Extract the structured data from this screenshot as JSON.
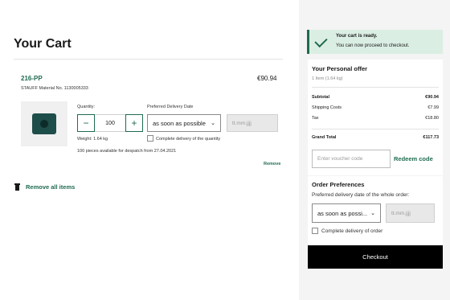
{
  "cart": {
    "title": "Your Cart",
    "remove_all_label": "Remove all items",
    "item": {
      "sku": "216-PP",
      "price": "€90.94",
      "material_no": "STAUFF Material No. 1130005333",
      "quantity_label": "Quantity:",
      "quantity_value": "100",
      "minus_glyph": "−",
      "plus_glyph": "+",
      "delivery_date_label": "Preferred Delivery Date",
      "delivery_option": "as soon as possible",
      "date_placeholder": "tt.mm.jjjj",
      "complete_delivery_label": "Complete delivery of the quantity",
      "weight": "Weight: 1.64 kg",
      "availability": "100 pieces available for despatch from 27.04.2021",
      "remove_label": "Remove"
    }
  },
  "notice": {
    "title": "Your cart is ready.",
    "message": "You can now proceed to checkout."
  },
  "offer": {
    "title": "Your Personal offer",
    "summary": "1 Item (1.64 kg)",
    "rows": [
      {
        "label": "Subtotal",
        "value": "€90.94"
      },
      {
        "label": "Shipping Costs",
        "value": "€7.99"
      },
      {
        "label": "Tax",
        "value": "€18.80"
      }
    ],
    "grand_total_label": "Grand Total",
    "grand_total_value": "€117.73",
    "voucher_placeholder": "Enter voucher code",
    "redeem_label": "Redeem code"
  },
  "order_preferences": {
    "title": "Order Preferences",
    "subtitle": "Preferred delivery date of the whole order:",
    "delivery_option": "as soon as possi...",
    "date_placeholder": "tt.mm.jjjj",
    "complete_delivery_label": "Complete delivery of order"
  },
  "checkout_label": "Checkout",
  "icons": {
    "notice": "check-icon",
    "remove_all": "trash-icon",
    "dropdown": "chevron-down-icon"
  },
  "colors": {
    "accent": "#1f6b4f",
    "notice_bg": "#dbeee4",
    "checkout_bg": "#000000",
    "sidebar_bg": "#f4f4f4"
  }
}
